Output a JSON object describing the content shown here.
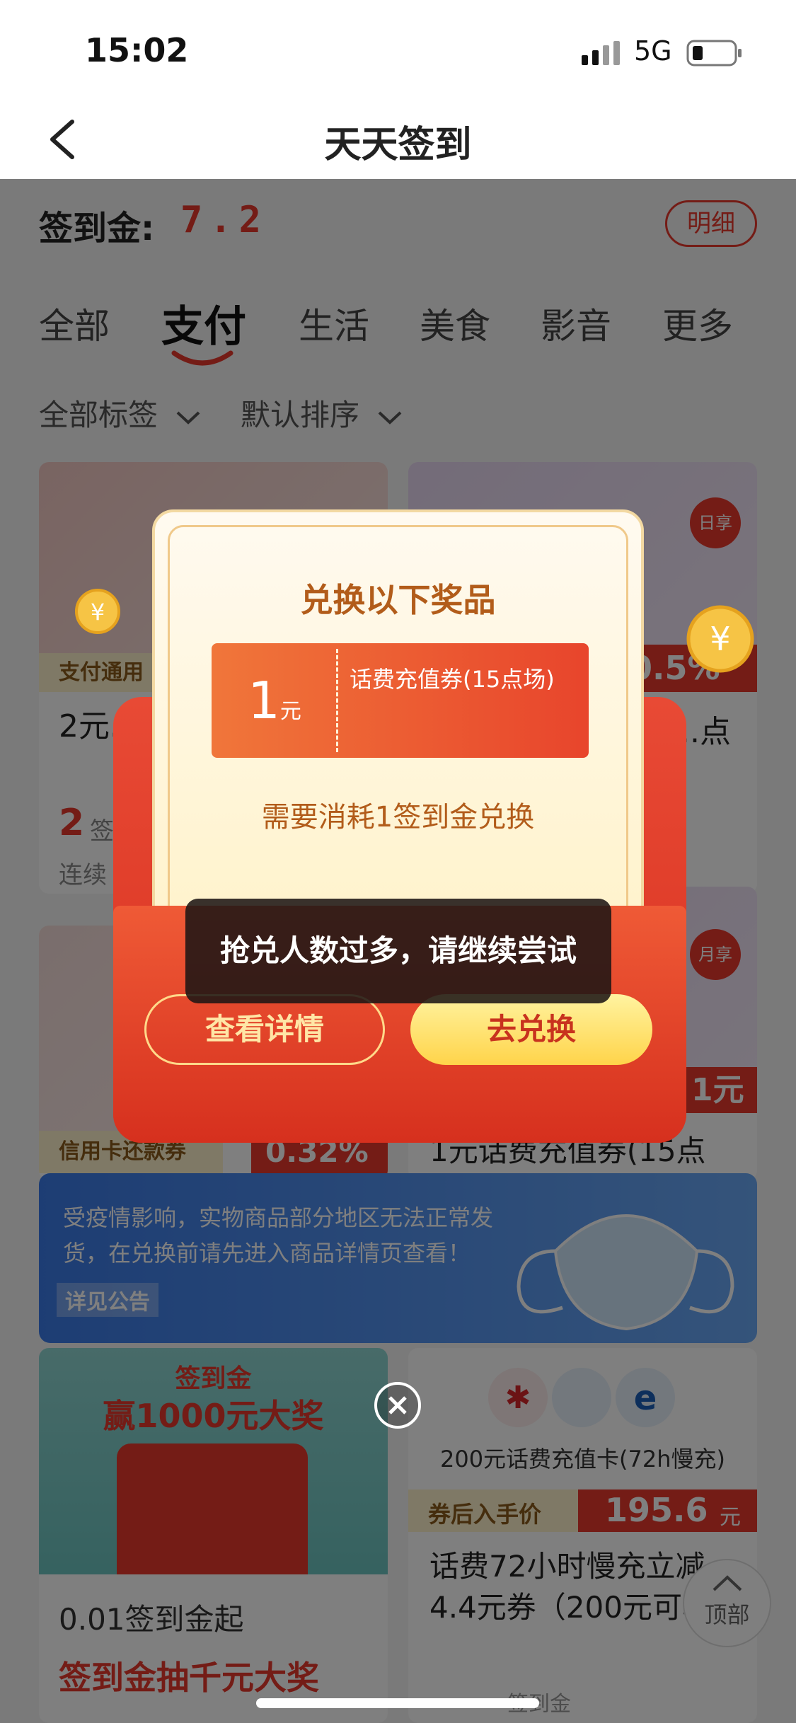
{
  "status_bar": {
    "time": "15:02",
    "network": "5G"
  },
  "nav": {
    "title": "天天签到"
  },
  "balance": {
    "label": "签到金:",
    "value": "7.2",
    "detail_button": "明细"
  },
  "tabs": [
    "全部",
    "支付",
    "生活",
    "美食",
    "影音",
    "更多"
  ],
  "active_tab": 1,
  "filters": {
    "tag": "全部标签",
    "sort": "默认排序"
  },
  "cards": {
    "c1": {
      "tag": "支付通用",
      "title": "2元...21日",
      "price_num": "2",
      "price_unit": "签",
      "sub": "连续"
    },
    "c2": {
      "corner": "日享",
      "discount": "0.5%",
      "title": "...点"
    },
    "c3": {
      "tag": "信用卡还款券",
      "discount": "0.32%"
    },
    "c4": {
      "corner": "月享",
      "price": "1元",
      "title": "1元话费充值券(15点"
    },
    "c5": {
      "banner_line1": "签到金",
      "banner_line2": "赢1000元大奖",
      "price_text": "0.01签到金起",
      "title": "签到金抽千元大奖"
    },
    "c6": {
      "card_label": "200元话费充值卡(72h慢充)",
      "tag": "券后入手价",
      "price": "195.6",
      "price_unit": "元",
      "title": "话费72小时慢充立减4.4元券（200元可享）",
      "foot": "签到金"
    }
  },
  "notice": {
    "text": "受疫情影响，实物商品部分地区无法正常发货，在兑换前请先进入商品详情页查看！",
    "link": "详见公告"
  },
  "back_top": "顶部",
  "modal": {
    "title": "兑换以下奖品",
    "coupon_amount": "1",
    "coupon_unit": "元",
    "coupon_name": "话费充值券(15点场)",
    "cost_text": "需要消耗1签到金兑换",
    "toast": "抢兑人数过多，请继续尝试",
    "detail_button": "查看详情",
    "exchange_button": "去兑换"
  },
  "colors": {
    "brand_red": "#e8392c",
    "gold": "#ffd44a",
    "text_red": "#c8321e"
  }
}
